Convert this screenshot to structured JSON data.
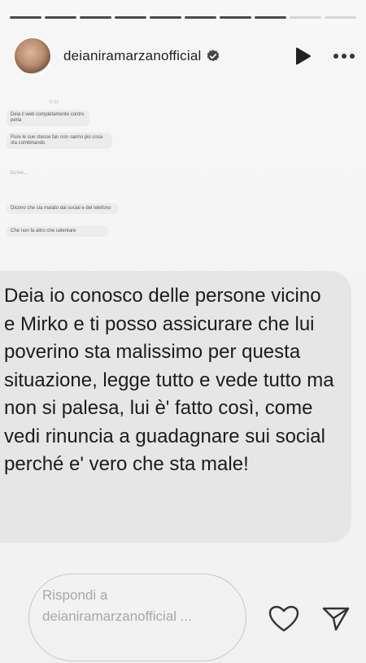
{
  "progress": {
    "total_segments": 10,
    "completed_segments": 8
  },
  "header": {
    "username": "deianiramarzanofficial"
  },
  "chat_screenshot": {
    "time": "11:02",
    "messages": [
      "Deia il web completamente contro perla",
      "Pure le sue stesse fan non sanno più cosa sta combinando",
      "Dicono che sia malato dai social e del telefono",
      "Che non fa altro che celentare"
    ],
    "typing": "Scrive..."
  },
  "message": {
    "text": "Deia io conosco delle persone vicino e Mirko e ti posso assicurare che lui poverino sta malissimo per questa situazione, legge tutto e vede tutto ma non si palesa, lui è' fatto così, come vedi rinuncia a guadagnare sui social perché e' vero che sta male!"
  },
  "footer": {
    "reply_placeholder": "Rispondi a deianiramarzanofficial ..."
  },
  "icons": {
    "verified": "verified-badge-icon",
    "play": "play-icon",
    "more": "more-options-icon",
    "like": "heart-icon",
    "share": "send-icon"
  }
}
